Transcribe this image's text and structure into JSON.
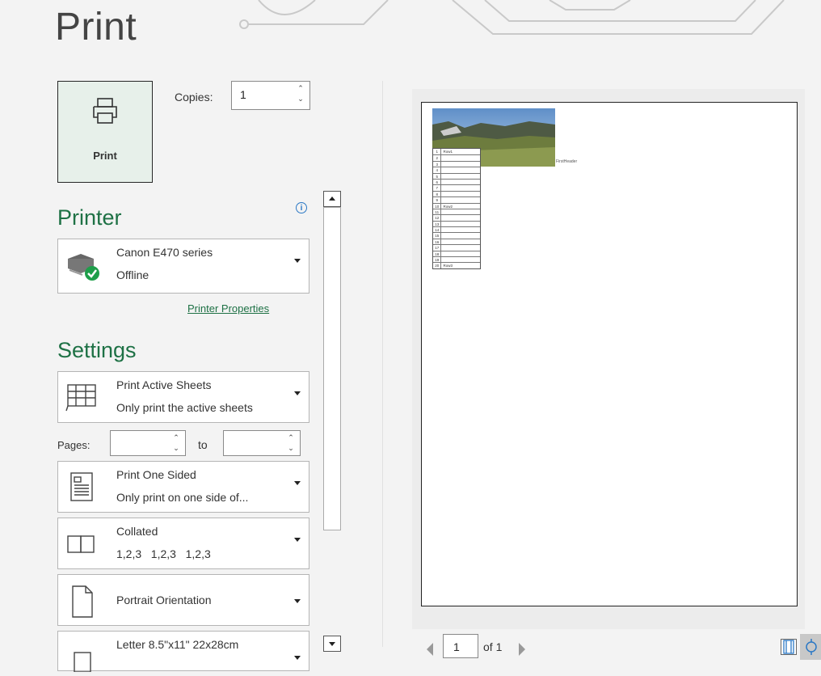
{
  "page": {
    "title": "Print"
  },
  "print_button": {
    "label": "Print",
    "icon": "printer-icon"
  },
  "copies": {
    "label": "Copies:",
    "value": "1"
  },
  "printer": {
    "heading": "Printer",
    "info_icon": "info-icon",
    "name": "Canon E470 series",
    "status": "Offline",
    "properties_link": "Printer Properties"
  },
  "settings": {
    "heading": "Settings",
    "print_what": {
      "title": "Print Active Sheets",
      "subtitle": "Only print the active sheets"
    },
    "pages": {
      "label": "Pages:",
      "from": "",
      "to_label": "to",
      "to": ""
    },
    "sides": {
      "title": "Print One Sided",
      "subtitle": "Only print on one side of..."
    },
    "collation": {
      "title": "Collated",
      "subtitle": "1,2,3   1,2,3   1,2,3"
    },
    "orientation": {
      "title": "Portrait Orientation"
    },
    "paper": {
      "title": "Letter 8.5\"x11\" 22x28cm"
    }
  },
  "preview": {
    "current_page": "1",
    "of_label": "of 1",
    "header_text": "FirstHeader",
    "row_numbers": [
      "1",
      "2",
      "3",
      "4",
      "5",
      "6",
      "7",
      "8",
      "9",
      "10",
      "11",
      "12",
      "13",
      "14",
      "15",
      "16",
      "17",
      "18",
      "19",
      "20"
    ],
    "cells": {
      "1": "Row1",
      "10": "Row2",
      "20": "Row3"
    }
  },
  "colors": {
    "accent": "#1e7145",
    "print_button_bg": "#e7f0ea"
  }
}
